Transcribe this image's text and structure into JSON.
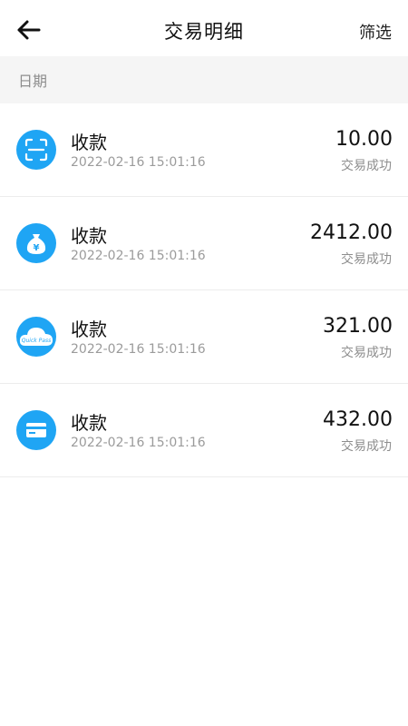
{
  "header": {
    "title": "交易明细",
    "filter_label": "筛选",
    "back_icon": "arrow-left-icon"
  },
  "date_bar": {
    "label": "日期"
  },
  "transactions": [
    {
      "name": "收款",
      "time": "2022-02-16 15:01:16",
      "amount": "10.00",
      "status": "交易成功",
      "icon": "scan-icon"
    },
    {
      "name": "收款",
      "time": "2022-02-16 15:01:16",
      "amount": "2412.00",
      "status": "交易成功",
      "icon": "money-bag-icon",
      "icon_text": "¥"
    },
    {
      "name": "收款",
      "time": "2022-02-16 15:01:16",
      "amount": "321.00",
      "status": "交易成功",
      "icon": "quickpass-cloud-icon",
      "icon_text": "Quick Pass"
    },
    {
      "name": "收款",
      "time": "2022-02-16 15:01:16",
      "amount": "432.00",
      "status": "交易成功",
      "icon": "card-icon"
    }
  ],
  "colors": {
    "accent": "#1fa5f4",
    "date_bar_bg": "#f5f5f5",
    "muted_text": "#9b9b9b"
  }
}
